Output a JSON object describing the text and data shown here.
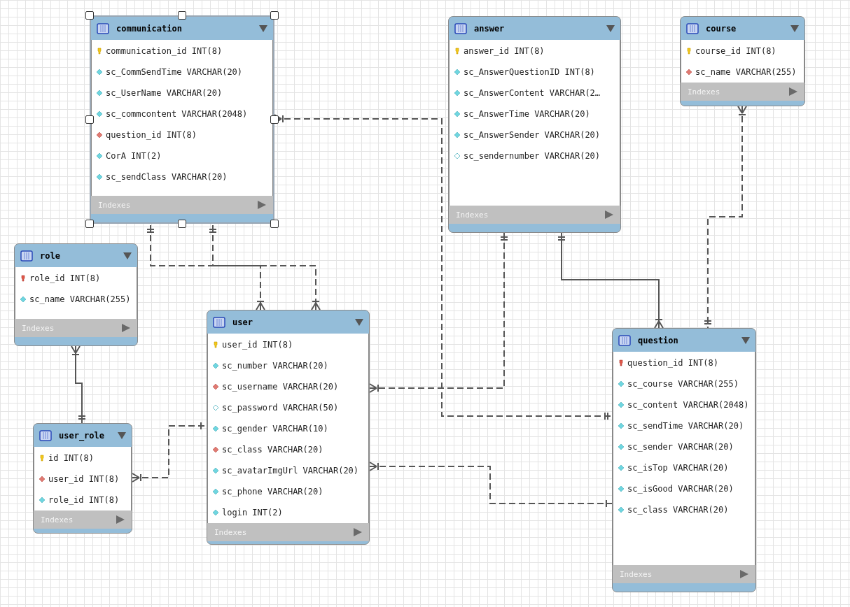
{
  "tables": [
    {
      "name": "communication",
      "selected": true,
      "indexes": "Indexes",
      "columns": [
        {
          "text": "communication_id INT(8)",
          "kind": "pk"
        },
        {
          "text": "sc_CommSendTime VARCHAR(20)",
          "kind": "col"
        },
        {
          "text": "sc_UserName VARCHAR(20)",
          "kind": "col"
        },
        {
          "text": "sc_commcontent VARCHAR(2048)",
          "kind": "col"
        },
        {
          "text": "question_id INT(8)",
          "kind": "fk"
        },
        {
          "text": "CorA INT(2)",
          "kind": "col"
        },
        {
          "text": "sc_sendClass VARCHAR(20)",
          "kind": "col"
        }
      ]
    },
    {
      "name": "answer",
      "selected": false,
      "indexes": "Indexes",
      "columns": [
        {
          "text": "answer_id INT(8)",
          "kind": "pk"
        },
        {
          "text": "sc_AnswerQuestionID INT(8)",
          "kind": "col"
        },
        {
          "text": "sc_AnswerContent VARCHAR(2…",
          "kind": "col"
        },
        {
          "text": "sc_AnswerTime VARCHAR(20)",
          "kind": "col"
        },
        {
          "text": "sc_AnswerSender VARCHAR(20)",
          "kind": "col"
        },
        {
          "text": "sc_sendernumber VARCHAR(20)",
          "kind": "nullable"
        }
      ]
    },
    {
      "name": "course",
      "selected": false,
      "indexes": "Indexes",
      "columns": [
        {
          "text": "course_id INT(8)",
          "kind": "pk"
        },
        {
          "text": "sc_name VARCHAR(255)",
          "kind": "fk"
        }
      ]
    },
    {
      "name": "role",
      "selected": false,
      "indexes": "Indexes",
      "columns": [
        {
          "text": "role_id INT(8)",
          "kind": "pkfk"
        },
        {
          "text": "sc_name VARCHAR(255)",
          "kind": "col"
        }
      ]
    },
    {
      "name": "user",
      "selected": false,
      "indexes": "Indexes",
      "columns": [
        {
          "text": "user_id INT(8)",
          "kind": "pk"
        },
        {
          "text": "sc_number VARCHAR(20)",
          "kind": "col"
        },
        {
          "text": "sc_username VARCHAR(20)",
          "kind": "fk"
        },
        {
          "text": "sc_password VARCHAR(50)",
          "kind": "nullable"
        },
        {
          "text": "sc_gender VARCHAR(10)",
          "kind": "col"
        },
        {
          "text": "sc_class VARCHAR(20)",
          "kind": "fk"
        },
        {
          "text": "sc_avatarImgUrl VARCHAR(20)",
          "kind": "col"
        },
        {
          "text": "sc_phone VARCHAR(20)",
          "kind": "col"
        },
        {
          "text": "login INT(2)",
          "kind": "col"
        }
      ]
    },
    {
      "name": "user_role",
      "selected": false,
      "indexes": "Indexes",
      "columns": [
        {
          "text": "id INT(8)",
          "kind": "pk"
        },
        {
          "text": "user_id INT(8)",
          "kind": "fk"
        },
        {
          "text": "role_id INT(8)",
          "kind": "col"
        }
      ]
    },
    {
      "name": "question",
      "selected": false,
      "indexes": "Indexes",
      "columns": [
        {
          "text": "question_id INT(8)",
          "kind": "pkfk"
        },
        {
          "text": "sc_course VARCHAR(255)",
          "kind": "col"
        },
        {
          "text": "sc_content VARCHAR(2048)",
          "kind": "col"
        },
        {
          "text": "sc_sendTime VARCHAR(20)",
          "kind": "col"
        },
        {
          "text": "sc_sender VARCHAR(20)",
          "kind": "col"
        },
        {
          "text": "sc_isTop VARCHAR(20)",
          "kind": "col"
        },
        {
          "text": "sc_isGood VARCHAR(20)",
          "kind": "col"
        },
        {
          "text": "sc_class VARCHAR(20)",
          "kind": "col"
        }
      ]
    }
  ]
}
